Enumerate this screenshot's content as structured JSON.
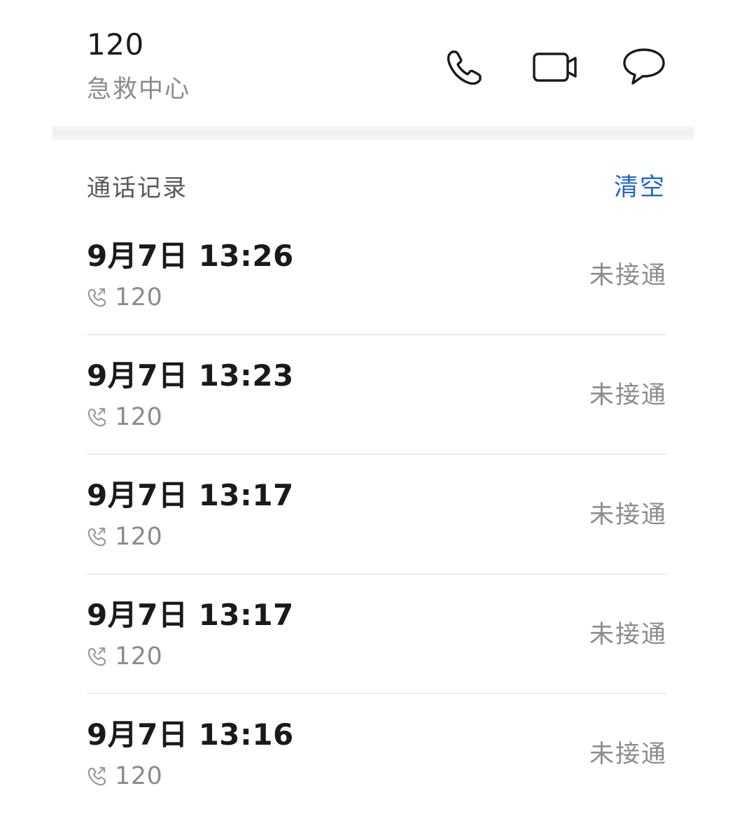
{
  "contact": {
    "number": "120",
    "name": "急救中心"
  },
  "actions": {
    "call_icon": "phone-icon",
    "video_icon": "video-camera-icon",
    "message_icon": "chat-bubble-icon"
  },
  "call_log": {
    "title": "通话记录",
    "clear_label": "清空",
    "accent_color": "#1e63d6",
    "records": [
      {
        "datetime": "9月7日 13:26",
        "number": "120",
        "status": "未接通",
        "icon": "outgoing-call-icon"
      },
      {
        "datetime": "9月7日 13:23",
        "number": "120",
        "status": "未接通",
        "icon": "outgoing-call-icon"
      },
      {
        "datetime": "9月7日 13:17",
        "number": "120",
        "status": "未接通",
        "icon": "outgoing-call-icon"
      },
      {
        "datetime": "9月7日 13:17",
        "number": "120",
        "status": "未接通",
        "icon": "outgoing-call-icon"
      },
      {
        "datetime": "9月7日 13:16",
        "number": "120",
        "status": "未接通",
        "icon": "outgoing-call-icon"
      }
    ]
  }
}
